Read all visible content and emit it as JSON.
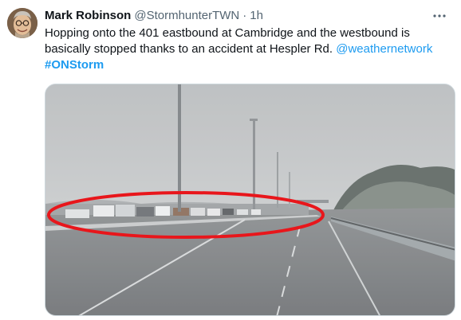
{
  "tweet": {
    "author_name": "Mark Robinson",
    "author_handle": "@StormhunterTWN",
    "separator": "·",
    "timestamp": "1h",
    "more_icon": "more-horizontal-icon",
    "text_main": "Hopping onto the 401 eastbound at Cambridge and the westbound is basically stopped thanks to an accident at Hespler Rd.",
    "mention": "@weathernetwork",
    "hashtag": "#ONStorm",
    "link_color": "#1d9bf0"
  },
  "media": {
    "kind": "highway-snow-photo",
    "annotation_color": "#e8161b"
  }
}
